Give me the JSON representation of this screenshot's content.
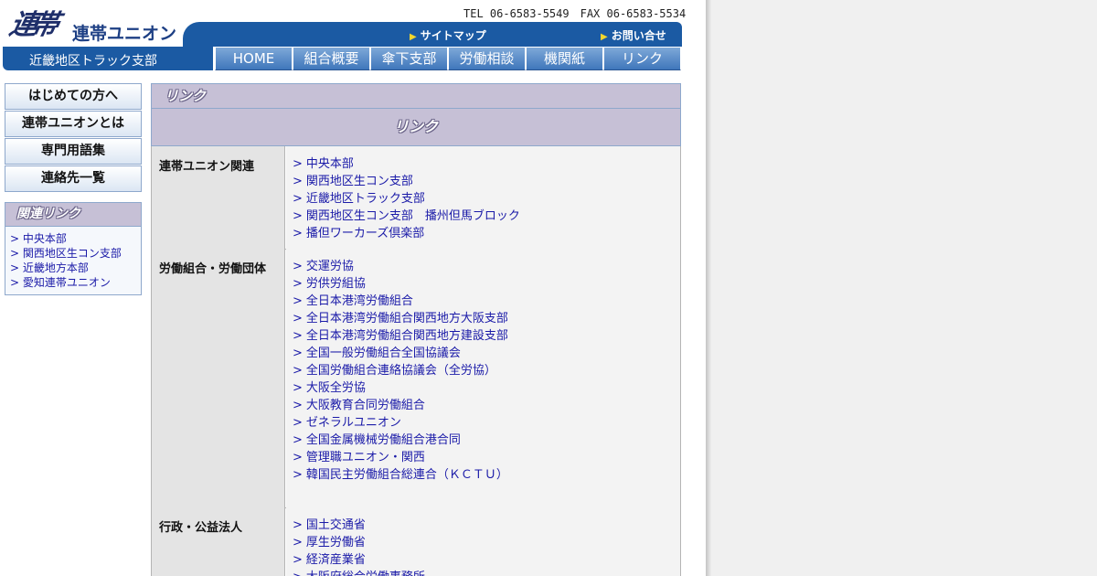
{
  "header": {
    "logo_mark": "連帯",
    "org_name": "連帯ユニオン",
    "branch": "近畿地区トラック支部",
    "contact": "TEL 06-6583-5549　FAX 06-6583-5534",
    "sitemap_label": "サイトマップ",
    "contact_label": "お問い合せ",
    "arrow_icon": "▶"
  },
  "nav": [
    "HOME",
    "組合概要",
    "傘下支部",
    "労働相談",
    "機関紙",
    "リンク"
  ],
  "sidebar": {
    "buttons": [
      "はじめての方へ",
      "連帯ユニオンとは",
      "専門用語集",
      "連絡先一覧"
    ],
    "related_title": "関連リンク",
    "related_links": [
      "中央本部",
      "関西地区生コン支部",
      "近畿地方本部",
      "愛知連帯ユニオン"
    ]
  },
  "main": {
    "page_title": "リンク",
    "section_title": "リンク",
    "link_prefix": ">",
    "categories": [
      {
        "label": "連帯ユニオン関連",
        "links": [
          "中央本部",
          "関西地区生コン支部",
          "近畿地区トラック支部",
          "関西地区生コン支部　播州但馬ブロック",
          "播但ワーカーズ倶楽部"
        ]
      },
      {
        "label": "労働組合・労働団体",
        "links": [
          "交運労協",
          "労供労組協",
          "全日本港湾労働組合",
          "全日本港湾労働組合関西地方大阪支部",
          "全日本港湾労働組合関西地方建設支部",
          "全国一般労働組合全国協議会",
          "全国労働組合連絡協議会（全労協）",
          "大阪全労協",
          "大阪教育合同労働組合",
          "ゼネラルユニオン",
          "全国金属機械労働組合港合同",
          "管理職ユニオン・関西",
          "韓国民主労働組合総連合（ＫＣＴＵ）"
        ]
      },
      {
        "label": "行政・公益法人",
        "links": [
          "国土交通省",
          "厚生労働省",
          "経済産業省",
          "大阪府総合労働事務所"
        ]
      }
    ]
  },
  "colors": {
    "brand_blue": "#1b5aa3",
    "heading_lavender": "#c6c0d6",
    "link_blue": "#1a1aa8",
    "arrow_yellow": "#f2d62c"
  }
}
